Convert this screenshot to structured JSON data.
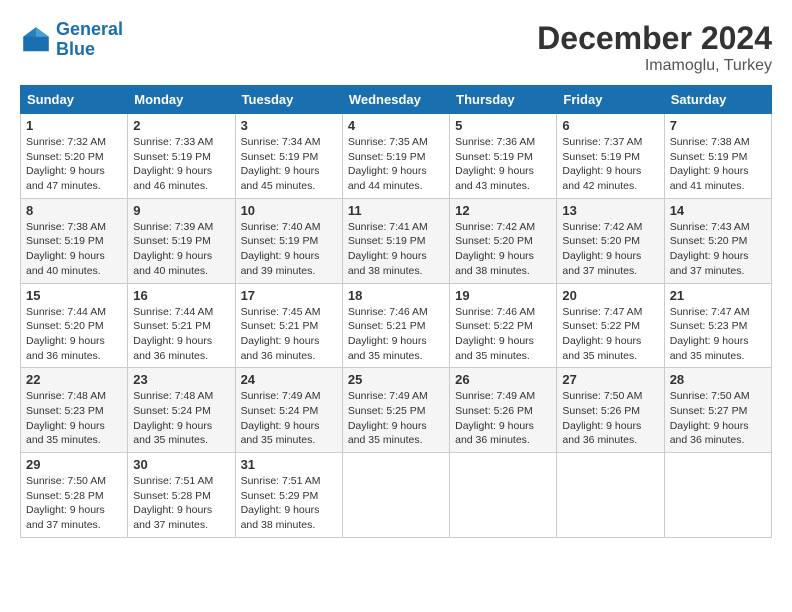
{
  "header": {
    "logo_line1": "General",
    "logo_line2": "Blue",
    "month": "December 2024",
    "location": "Imamoglu, Turkey"
  },
  "weekdays": [
    "Sunday",
    "Monday",
    "Tuesday",
    "Wednesday",
    "Thursday",
    "Friday",
    "Saturday"
  ],
  "weeks": [
    [
      {
        "day": "1",
        "sunrise": "7:32 AM",
        "sunset": "5:20 PM",
        "daylight": "9 hours and 47 minutes."
      },
      {
        "day": "2",
        "sunrise": "7:33 AM",
        "sunset": "5:19 PM",
        "daylight": "9 hours and 46 minutes."
      },
      {
        "day": "3",
        "sunrise": "7:34 AM",
        "sunset": "5:19 PM",
        "daylight": "9 hours and 45 minutes."
      },
      {
        "day": "4",
        "sunrise": "7:35 AM",
        "sunset": "5:19 PM",
        "daylight": "9 hours and 44 minutes."
      },
      {
        "day": "5",
        "sunrise": "7:36 AM",
        "sunset": "5:19 PM",
        "daylight": "9 hours and 43 minutes."
      },
      {
        "day": "6",
        "sunrise": "7:37 AM",
        "sunset": "5:19 PM",
        "daylight": "9 hours and 42 minutes."
      },
      {
        "day": "7",
        "sunrise": "7:38 AM",
        "sunset": "5:19 PM",
        "daylight": "9 hours and 41 minutes."
      }
    ],
    [
      {
        "day": "8",
        "sunrise": "7:38 AM",
        "sunset": "5:19 PM",
        "daylight": "9 hours and 40 minutes."
      },
      {
        "day": "9",
        "sunrise": "7:39 AM",
        "sunset": "5:19 PM",
        "daylight": "9 hours and 40 minutes."
      },
      {
        "day": "10",
        "sunrise": "7:40 AM",
        "sunset": "5:19 PM",
        "daylight": "9 hours and 39 minutes."
      },
      {
        "day": "11",
        "sunrise": "7:41 AM",
        "sunset": "5:19 PM",
        "daylight": "9 hours and 38 minutes."
      },
      {
        "day": "12",
        "sunrise": "7:42 AM",
        "sunset": "5:20 PM",
        "daylight": "9 hours and 38 minutes."
      },
      {
        "day": "13",
        "sunrise": "7:42 AM",
        "sunset": "5:20 PM",
        "daylight": "9 hours and 37 minutes."
      },
      {
        "day": "14",
        "sunrise": "7:43 AM",
        "sunset": "5:20 PM",
        "daylight": "9 hours and 37 minutes."
      }
    ],
    [
      {
        "day": "15",
        "sunrise": "7:44 AM",
        "sunset": "5:20 PM",
        "daylight": "9 hours and 36 minutes."
      },
      {
        "day": "16",
        "sunrise": "7:44 AM",
        "sunset": "5:21 PM",
        "daylight": "9 hours and 36 minutes."
      },
      {
        "day": "17",
        "sunrise": "7:45 AM",
        "sunset": "5:21 PM",
        "daylight": "9 hours and 36 minutes."
      },
      {
        "day": "18",
        "sunrise": "7:46 AM",
        "sunset": "5:21 PM",
        "daylight": "9 hours and 35 minutes."
      },
      {
        "day": "19",
        "sunrise": "7:46 AM",
        "sunset": "5:22 PM",
        "daylight": "9 hours and 35 minutes."
      },
      {
        "day": "20",
        "sunrise": "7:47 AM",
        "sunset": "5:22 PM",
        "daylight": "9 hours and 35 minutes."
      },
      {
        "day": "21",
        "sunrise": "7:47 AM",
        "sunset": "5:23 PM",
        "daylight": "9 hours and 35 minutes."
      }
    ],
    [
      {
        "day": "22",
        "sunrise": "7:48 AM",
        "sunset": "5:23 PM",
        "daylight": "9 hours and 35 minutes."
      },
      {
        "day": "23",
        "sunrise": "7:48 AM",
        "sunset": "5:24 PM",
        "daylight": "9 hours and 35 minutes."
      },
      {
        "day": "24",
        "sunrise": "7:49 AM",
        "sunset": "5:24 PM",
        "daylight": "9 hours and 35 minutes."
      },
      {
        "day": "25",
        "sunrise": "7:49 AM",
        "sunset": "5:25 PM",
        "daylight": "9 hours and 35 minutes."
      },
      {
        "day": "26",
        "sunrise": "7:49 AM",
        "sunset": "5:26 PM",
        "daylight": "9 hours and 36 minutes."
      },
      {
        "day": "27",
        "sunrise": "7:50 AM",
        "sunset": "5:26 PM",
        "daylight": "9 hours and 36 minutes."
      },
      {
        "day": "28",
        "sunrise": "7:50 AM",
        "sunset": "5:27 PM",
        "daylight": "9 hours and 36 minutes."
      }
    ],
    [
      {
        "day": "29",
        "sunrise": "7:50 AM",
        "sunset": "5:28 PM",
        "daylight": "9 hours and 37 minutes."
      },
      {
        "day": "30",
        "sunrise": "7:51 AM",
        "sunset": "5:28 PM",
        "daylight": "9 hours and 37 minutes."
      },
      {
        "day": "31",
        "sunrise": "7:51 AM",
        "sunset": "5:29 PM",
        "daylight": "9 hours and 38 minutes."
      },
      null,
      null,
      null,
      null
    ]
  ]
}
